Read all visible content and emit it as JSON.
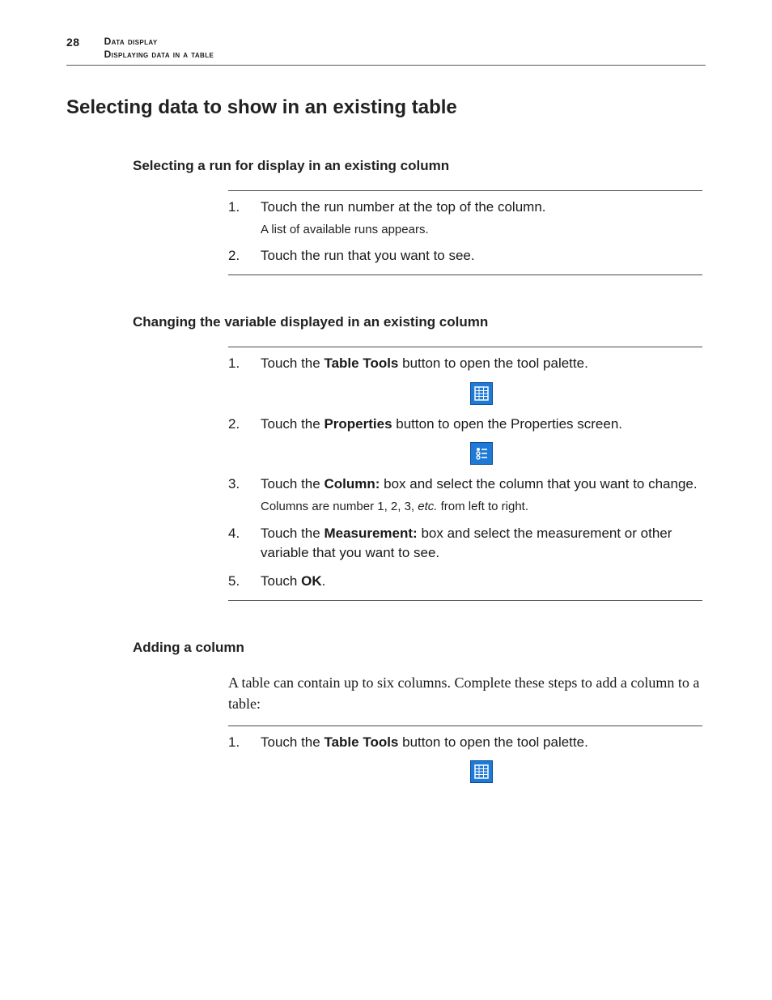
{
  "header": {
    "page_number": "28",
    "line1": "Data display",
    "line2": "Displaying data in a table"
  },
  "title": "Selecting data to show in an existing table",
  "sec1": {
    "heading": "Selecting a run for display in an existing column",
    "s1_num": "1.",
    "s1_text": "Touch the run number at the top of the column.",
    "s1_sub": "A list of available runs appears.",
    "s2_num": "2.",
    "s2_text": "Touch the run that you want to see."
  },
  "sec2": {
    "heading": "Changing the variable displayed in an existing column",
    "s1_num": "1.",
    "s1_a": "Touch the ",
    "s1_b": "Table Tools",
    "s1_c": " button to open the tool palette.",
    "s2_num": "2.",
    "s2_a": "Touch the ",
    "s2_b": "Properties",
    "s2_c": " button to open the Properties screen.",
    "s3_num": "3.",
    "s3_a": "Touch the ",
    "s3_b": "Column:",
    "s3_c": " box and select the column that you want to change.",
    "s3_sub_a": "Columns are number 1, 2, 3, ",
    "s3_sub_b": "etc.",
    "s3_sub_c": " from left to right.",
    "s4_num": "4.",
    "s4_a": "Touch the ",
    "s4_b": "Measurement:",
    "s4_c": " box and select the measurement or other variable that you want to see.",
    "s5_num": "5.",
    "s5_a": "Touch ",
    "s5_b": "OK",
    "s5_c": "."
  },
  "sec3": {
    "heading": "Adding a column",
    "intro": "A table can contain up to six columns. Complete these steps to add a column to a table:",
    "s1_num": "1.",
    "s1_a": "Touch the ",
    "s1_b": "Table Tools",
    "s1_c": " button to open the tool palette."
  }
}
